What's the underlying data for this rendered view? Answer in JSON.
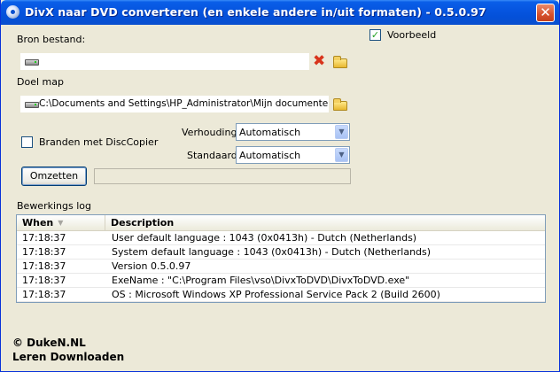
{
  "window": {
    "title": "DivX naar DVD converteren (en enkele andere in/uit formaten) - 0.5.0.97",
    "close_label": "✕"
  },
  "source": {
    "label": "Bron bestand:",
    "value": ""
  },
  "preview": {
    "label": "Voorbeeld",
    "checked": true
  },
  "target": {
    "label": "Doel map",
    "value": "C:\\Documents and Settings\\HP_Administrator\\Mijn documenten\\Div›"
  },
  "burn": {
    "label": "Branden met DiscCopier",
    "checked": false
  },
  "ratio": {
    "label": "Verhouding",
    "value": "Automatisch"
  },
  "standard": {
    "label": "Standaard",
    "value": "Automatisch"
  },
  "convert": {
    "label": "Omzetten"
  },
  "progress": {
    "value": 0
  },
  "log": {
    "label": "Bewerkings log",
    "columns": [
      "When",
      "Description"
    ],
    "rows": [
      {
        "when": "17:18:37",
        "description": "User default language : 1043 (0x0413h) - Dutch (Netherlands)"
      },
      {
        "when": "17:18:37",
        "description": "System default language : 1043 (0x0413h) - Dutch (Netherlands)"
      },
      {
        "when": "17:18:37",
        "description": "Version 0.5.0.97"
      },
      {
        "when": "17:18:37",
        "description": "ExeName : \"C:\\Program Files\\vso\\DivxToDVD\\DivxToDVD.exe\""
      },
      {
        "when": "17:18:37",
        "description": "OS : Microsoft Windows XP Professional Service Pack 2 (Build 2600)"
      }
    ]
  },
  "watermark": {
    "line1": "© DukeN.NL",
    "line2": "Leren Downloaden"
  },
  "icons": {
    "app": "app-icon",
    "drive": "drive-icon",
    "clear": "clear-x-icon",
    "folder": "folder-open-icon",
    "sort": "sort-descending-icon",
    "dropdown": "chevron-down-icon"
  }
}
